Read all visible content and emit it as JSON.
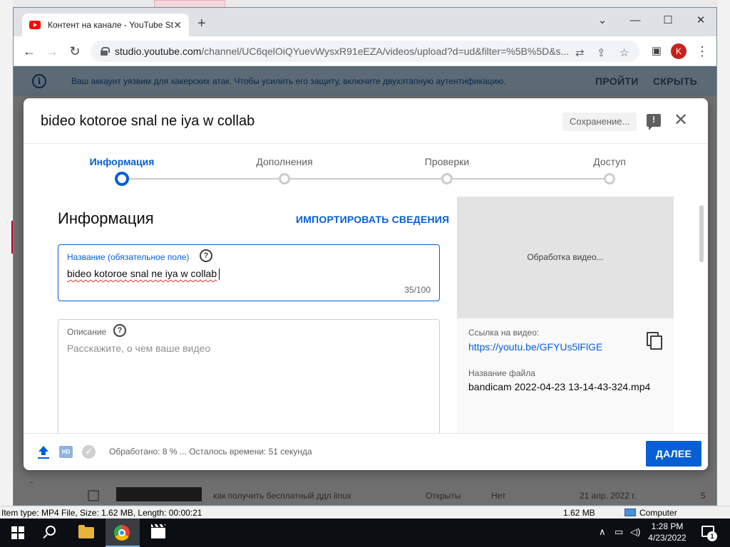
{
  "browser": {
    "tab_title": "Контент на канале - YouTube Studio",
    "new_tab": "+",
    "url_domain": "studio.youtube.com",
    "url_path": "/channel/UC6qelOiQYuevWysxR91eEZA/videos/upload?d=ud&filter=%5B%5D&s...",
    "profile_initial": "K"
  },
  "banner": {
    "text": "Ваш аккаунт уязвим для хакерских атак. Чтобы усилить его защиту, включите двухэтапную аутентификацию.",
    "go_label": "ПРОЙТИ",
    "hide_label": "СКРЫТЬ"
  },
  "modal": {
    "title": "bideo kotoroe snal ne iya w collab",
    "saving_label": "Сохранение...",
    "steps": [
      "Информация",
      "Дополнения",
      "Проверки",
      "Доступ"
    ],
    "section_title": "Информация",
    "import_label": "ИМПОРТИРОВАТЬ СВЕДЕНИЯ",
    "title_field": {
      "label": "Название (обязательное поле)",
      "value": "bideo kotoroe snal ne iya w collab",
      "count": "35/100"
    },
    "description_field": {
      "label": "Описание",
      "placeholder": "Расскажите, о чем ваше видео"
    },
    "preview": {
      "processing": "Обработка видео...",
      "link_label": "Ссылка на видео:",
      "link": "https://youtu.be/GFYUs5lFlGE",
      "filename_label": "Название файла",
      "filename": "bandicam 2022-04-23 13-14-43-324.mp4"
    },
    "footer": {
      "hd": "HD",
      "status": "Обработано: 8 % ... Осталось времени: 51 секунда",
      "next_label": "ДАЛЕЕ"
    }
  },
  "background_list": {
    "title": "как получить бесплатный ддл linux",
    "visibility": "Открыты",
    "restrictions": "Нет",
    "date": "21 апр. 2022 г.",
    "count": "5"
  },
  "explorer_status": {
    "item_info": "Item type: MP4 File, Size: 1.62 MB, Length: 00:00:21",
    "size": "1.62 MB",
    "location": "Computer"
  },
  "taskbar": {
    "time": "1:28 PM",
    "date": "4/23/2022",
    "notifications": "1"
  },
  "colors": {
    "accent": "#065fd4",
    "banner_bg": "#5b6a75",
    "youtube_red": "#ff0000"
  }
}
